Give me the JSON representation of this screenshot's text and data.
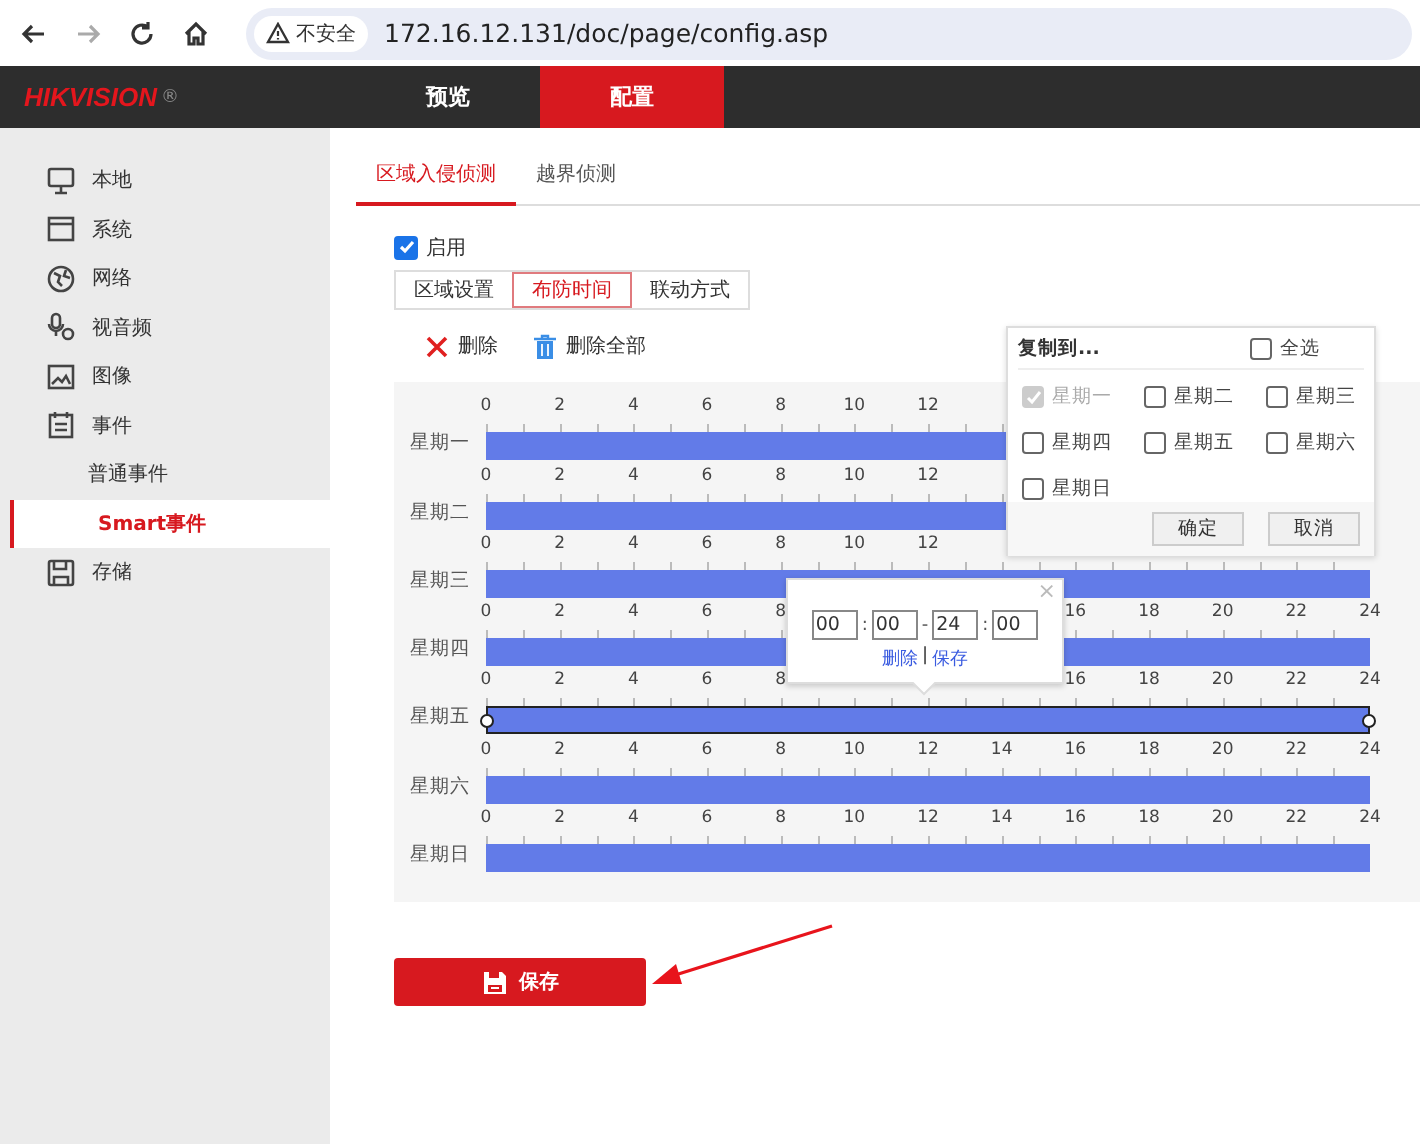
{
  "browser": {
    "nav": [
      {
        "kind": "back",
        "disabled": false
      },
      {
        "kind": "forward",
        "disabled": true
      },
      {
        "kind": "reload",
        "disabled": false
      },
      {
        "kind": "home",
        "disabled": false
      }
    ],
    "security": "不安全",
    "url": "172.16.12.131/doc/page/config.asp"
  },
  "header": {
    "logo": "HIKVISION",
    "logo_mark": "®",
    "tabs": [
      {
        "label": "预览",
        "selected": false
      },
      {
        "label": "配置",
        "selected": true
      }
    ]
  },
  "sidebar": {
    "items": [
      {
        "label": "本地",
        "selected": false
      },
      {
        "label": "系统",
        "selected": false
      },
      {
        "label": "网络",
        "selected": false
      },
      {
        "label": "视音频",
        "selected": false
      },
      {
        "label": "图像",
        "selected": false
      },
      {
        "label": "事件",
        "selected": false,
        "children": [
          {
            "label": "普通事件",
            "selected": false
          },
          {
            "label": "Smart事件",
            "selected": true
          }
        ]
      },
      {
        "label": "存储",
        "selected": false
      }
    ]
  },
  "subtabs": [
    {
      "label": "区域入侵侦测",
      "selected": true
    },
    {
      "label": "越界侦测",
      "selected": false
    }
  ],
  "enable": {
    "label": "启用",
    "checked": true
  },
  "steps": [
    {
      "label": "区域设置",
      "selected": false
    },
    {
      "label": "布防时间",
      "selected": true
    },
    {
      "label": "联动方式",
      "selected": false
    }
  ],
  "toolbar": [
    {
      "kind": "delete",
      "label": "删除"
    },
    {
      "kind": "delete_all",
      "label": "删除全部"
    }
  ],
  "schedule": {
    "days": [
      {
        "label": "星期一",
        "selected": false,
        "ticks": [
          "0",
          "2",
          "4",
          "6",
          "8",
          "10",
          "12"
        ]
      },
      {
        "label": "星期二",
        "selected": false,
        "ticks": [
          "0",
          "2",
          "4",
          "6",
          "8",
          "10",
          "12"
        ]
      },
      {
        "label": "星期三",
        "selected": false,
        "ticks": [
          "0",
          "2",
          "4",
          "6",
          "8",
          "10",
          "12"
        ]
      },
      {
        "label": "星期四",
        "selected": false,
        "ticks": [
          "0",
          "2",
          "4",
          "6",
          "8"
        ],
        "ticks_end": [
          "16",
          "18",
          "20",
          "22",
          "24"
        ]
      },
      {
        "label": "星期五",
        "selected": true,
        "ticks": [
          "0",
          "2",
          "4",
          "6",
          "8"
        ],
        "ticks_end": [
          "16",
          "18",
          "20",
          "22",
          "24"
        ]
      },
      {
        "label": "星期六",
        "selected": false,
        "ticks": [
          "0",
          "2",
          "4",
          "6",
          "8",
          "10",
          "12",
          "14",
          "16",
          "18",
          "20",
          "22",
          "24"
        ]
      },
      {
        "label": "星期日",
        "selected": false,
        "ticks": [
          "0",
          "2",
          "4",
          "6",
          "8",
          "10",
          "12",
          "14",
          "16",
          "18",
          "20",
          "22",
          "24"
        ]
      }
    ]
  },
  "copy_popup": {
    "title": "复制到...",
    "select_all": {
      "label": "全选",
      "checked": false
    },
    "days": [
      {
        "label": "星期一",
        "checked": true,
        "disabled": true
      },
      {
        "label": "星期二",
        "checked": false,
        "disabled": false
      },
      {
        "label": "星期三",
        "checked": false,
        "disabled": false
      },
      {
        "label": "星期四",
        "checked": false,
        "disabled": false
      },
      {
        "label": "星期五",
        "checked": false,
        "disabled": false
      },
      {
        "label": "星期六",
        "checked": false,
        "disabled": false
      },
      {
        "label": "星期日",
        "checked": false,
        "disabled": false
      }
    ],
    "buttons": [
      "确定",
      "取消"
    ]
  },
  "time_editor": {
    "parts": [
      {
        "kind": "field",
        "text": "00"
      },
      {
        "kind": "sep",
        "text": ":"
      },
      {
        "kind": "field",
        "text": "00"
      },
      {
        "kind": "sep",
        "text": "-"
      },
      {
        "kind": "field",
        "text": "24"
      },
      {
        "kind": "sep",
        "text": ":"
      },
      {
        "kind": "field",
        "text": "00"
      }
    ],
    "links": [
      "删除",
      "保存"
    ],
    "divider": "|",
    "close": "×"
  },
  "save_button": "保存",
  "annotation": {
    "kind": "arrow"
  }
}
